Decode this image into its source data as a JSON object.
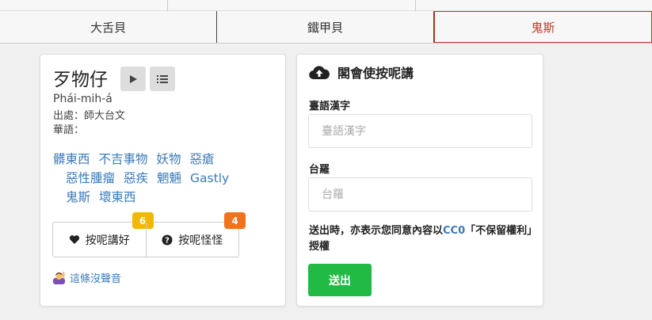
{
  "tabs": [
    {
      "label": "大舌貝"
    },
    {
      "label": "鐵甲貝"
    },
    {
      "label": "鬼斯"
    }
  ],
  "entry": {
    "word": "歹物仔",
    "romanization": "Phái-mih-á",
    "source": "出處：師大台文",
    "mandarin": "華語：",
    "tags": [
      "髒東西",
      "不吉事物",
      "妖物",
      "惡瘡",
      "惡性腫瘤",
      "惡疾",
      "魍魎",
      "Gastly",
      "鬼斯",
      "壞東西"
    ],
    "like_label": "按呢講好",
    "like_count": "6",
    "like_badge_color": "#f2b705",
    "weird_label": "按呢怪怪",
    "weird_count": "4",
    "weird_badge_color": "#f2711c",
    "no_sound_label": "這條沒聲音"
  },
  "contribute": {
    "title": "閣會使按呢講",
    "hanzi_label": "臺語漢字",
    "hanzi_placeholder": "臺語漢字",
    "lomaji_label": "台羅",
    "lomaji_placeholder": "台羅",
    "consent_pre": "送出時，亦表示您同意內容以",
    "consent_link": "CC0",
    "consent_post": "「不保留權利」授權",
    "submit_label": "送出"
  },
  "colors": {
    "link": "#3b7ab8",
    "active_tab": "#c0392b",
    "submit": "#21ba45"
  }
}
